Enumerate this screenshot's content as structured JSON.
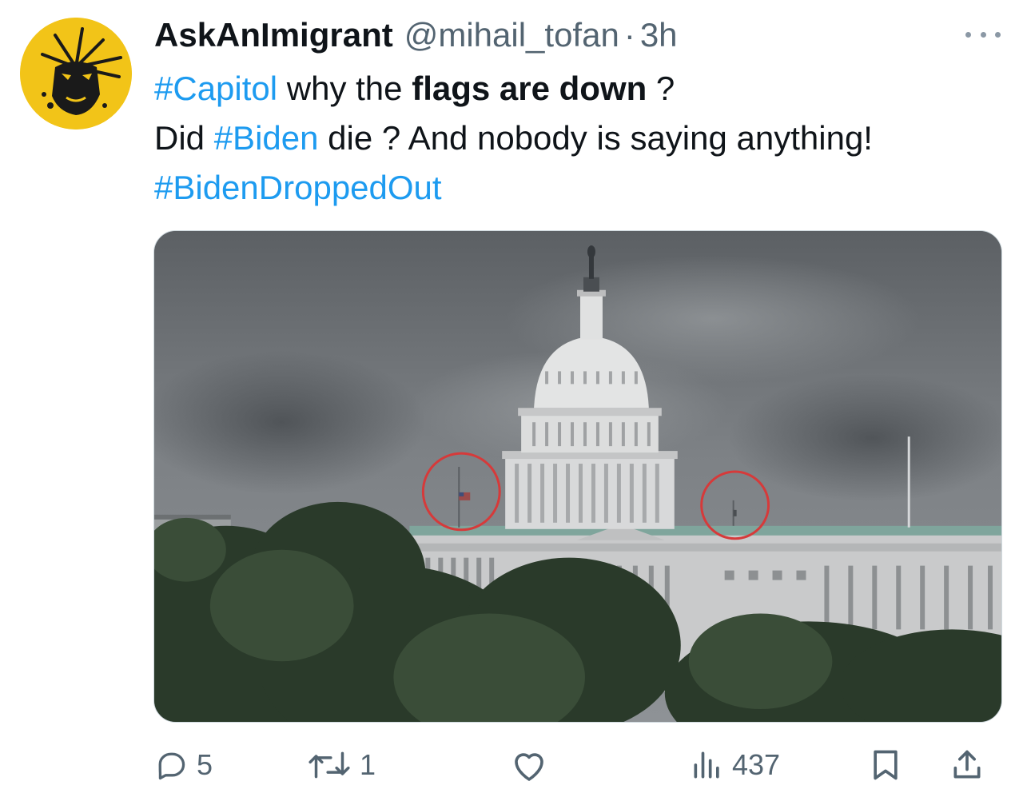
{
  "tweet": {
    "display_name": "AskAnImigrant",
    "handle": "@mihail_tofan",
    "separator": "·",
    "time": "3h",
    "more_icon": "more-horizontal-icon"
  },
  "text": {
    "line1": {
      "hashtag_capitol": "#Capitol",
      "why_the": " why the ",
      "flags_are_down": "flags are down",
      "question": " ?"
    },
    "line2": {
      "did": "Did ",
      "hashtag_biden": "#Biden",
      "rest": " die ? And nobody is saying anything!"
    },
    "line3": {
      "hashtag_dropped_out": "#BidenDroppedOut"
    }
  },
  "actions": {
    "reply_count": "5",
    "retweet_count": "1",
    "like_count": "",
    "views_count": "437",
    "icons": [
      "reply-icon",
      "retweet-icon",
      "like-icon",
      "views-icon",
      "bookmark-icon",
      "share-icon"
    ]
  },
  "colors": {
    "link": "#1d9bf0",
    "muted": "#536471",
    "avatar_bg": "#f2c418",
    "annotation_circle": "#d63a3a"
  }
}
